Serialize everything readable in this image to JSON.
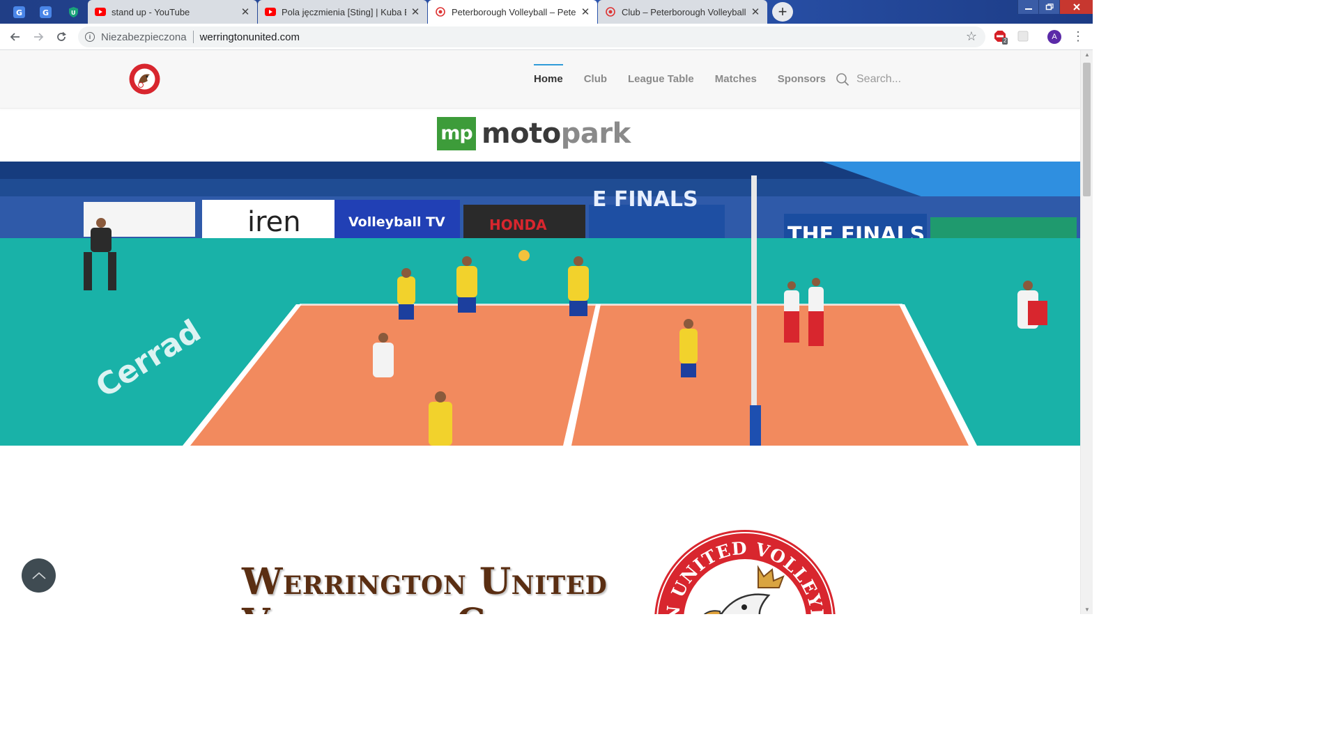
{
  "browser": {
    "pinned_tabs": [
      {
        "icon": "google-translate-icon"
      },
      {
        "icon": "google-translate-icon"
      },
      {
        "icon": "vpn-shield-icon"
      }
    ],
    "tabs": [
      {
        "title": "stand up - YouTube",
        "icon": "youtube-icon",
        "active": false
      },
      {
        "title": "Pola jęczmienia [Sting] | Kuba Blo",
        "icon": "youtube-icon",
        "active": false
      },
      {
        "title": "Peterborough Volleyball – Peterb",
        "icon": "site-favicon-icon",
        "active": true
      },
      {
        "title": "Club – Peterborough Volleyball",
        "icon": "site-favicon-icon",
        "active": false
      }
    ],
    "security_label": "Niezabezpieczona",
    "url": "werringtonunited.com",
    "extension_badge": "2",
    "profile_initial": "A",
    "colors": {
      "tab_strip": "#2b55b0",
      "youtube_red": "#ff0000",
      "profile": "#5b2aa8"
    }
  },
  "site": {
    "nav": {
      "items": [
        {
          "label": "Home",
          "active": true
        },
        {
          "label": "Club",
          "active": false
        },
        {
          "label": "League Table",
          "active": false
        },
        {
          "label": "Matches",
          "active": false
        },
        {
          "label": "Sponsors",
          "active": false
        }
      ],
      "active_color": "#2f9bd8"
    },
    "search": {
      "placeholder": "Search..."
    },
    "sponsor": {
      "badge": "mp",
      "name_part1": "moto",
      "name_part2": "park",
      "brand_color": "#3d9c3a"
    },
    "hero": {
      "banners": {
        "b1": "iren",
        "b2": "Volleyball TV",
        "b3": "HONDA",
        "b4": "THE FINALS",
        "b5": "E FINALS",
        "b6": "Cerrad"
      }
    },
    "headline": {
      "line1": "Werrington United",
      "line2": "Volleyball Club",
      "color": "#5a2e12"
    },
    "crest": {
      "text": "TON UNITED VOLLEYBAL"
    }
  }
}
